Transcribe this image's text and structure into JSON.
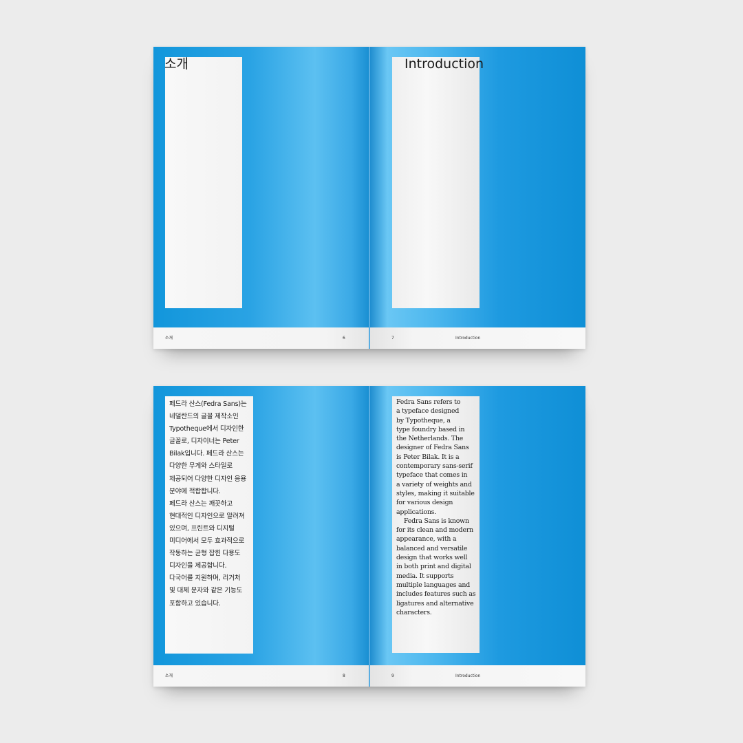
{
  "spreads": [
    {
      "left": {
        "heading": "소개",
        "footer_title": "소개",
        "page_number": "6",
        "body_lines": []
      },
      "right": {
        "heading": "Introduction",
        "footer_title": "Introduction",
        "page_number": "7",
        "body_lines": []
      }
    },
    {
      "left": {
        "heading": "",
        "footer_title": "소개",
        "page_number": "8",
        "body_lines": [
          "페드라 산스(Fedra Sans)는",
          "네덜란드의 글꼴 제작소인",
          "Typotheque에서 디자인한",
          "글꼴로, 디자이너는 Peter",
          "Bilak입니다. 페드라 산스는",
          "다양한 무게와 스타일로",
          "제공되어 다양한 디자인 응용",
          "분야에 적합합니다.",
          "페드라 산스는 깨끗하고",
          "현대적인 디자인으로 알려져",
          "있으며, 프린트와 디지털",
          "미디어에서 모두 효과적으로",
          "작동하는 균형 잡힌 다용도",
          "디자인을 제공합니다.",
          "다국어를 지원하며, 리거처",
          "및 대체 문자와 같은 기능도",
          "포함하고 있습니다."
        ]
      },
      "right": {
        "heading": "",
        "footer_title": "Introduction",
        "page_number": "9",
        "body_lines": [
          "Fedra Sans refers to",
          "a typeface designed",
          "by Typotheque, a",
          "type foundry based in",
          "the Netherlands. The",
          "designer of Fedra Sans",
          "is Peter Bilak. It is a",
          "contemporary sans-serif",
          "typeface that comes in",
          "a variety of weights and",
          "styles, making it suitable",
          "for various design",
          "applications.",
          "Fedra Sans is known",
          "for its clean and modern",
          "appearance, with a",
          "balanced and versatile",
          "design that works well",
          "in both print and digital",
          "media. It supports",
          "multiple languages and",
          "includes features such as",
          "ligatures and alternative",
          "characters."
        ]
      }
    }
  ],
  "colors": {
    "background": "#ececec",
    "page_blue": "#1296db",
    "page_blue_light": "#5cc0f1",
    "panel": "#f7f7f7",
    "footer": "#f5f5f5"
  }
}
